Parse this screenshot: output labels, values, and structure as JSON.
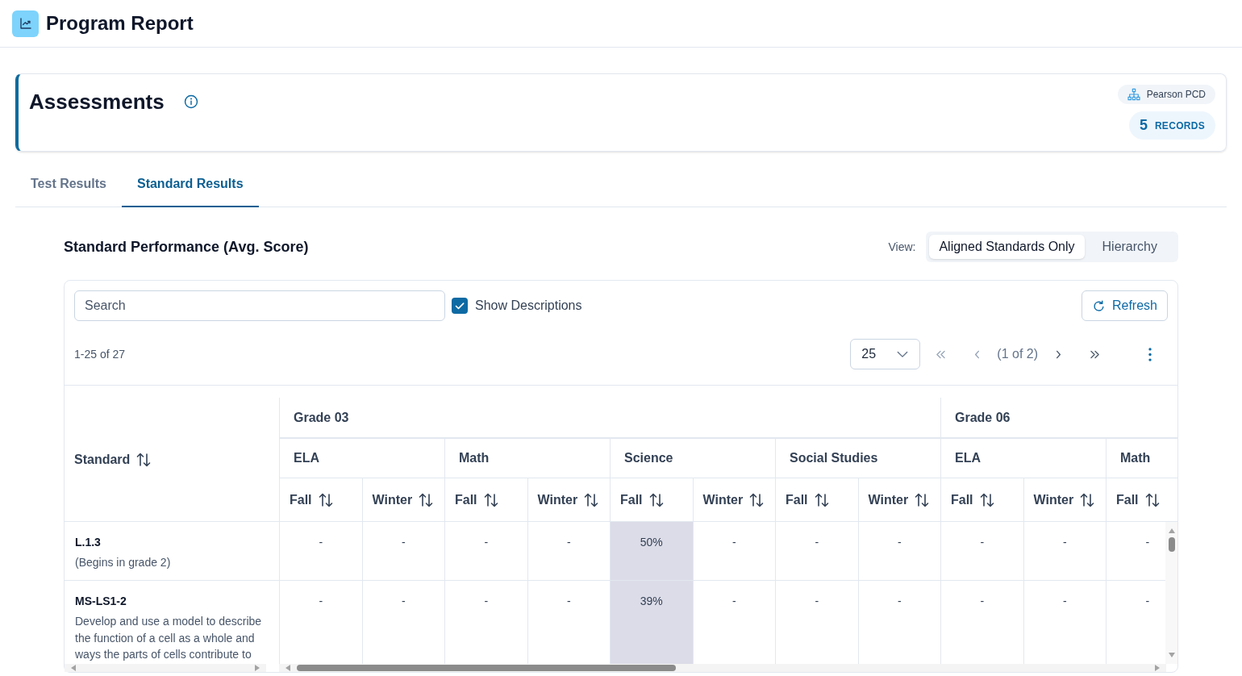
{
  "header": {
    "title": "Program Report"
  },
  "summary": {
    "title": "Assessments",
    "source": "Pearson PCD",
    "record_count": "5",
    "record_label": "RECORDS"
  },
  "tabs": [
    {
      "label": "Test Results",
      "selected": false
    },
    {
      "label": "Standard Results",
      "selected": true
    }
  ],
  "performance": {
    "title": "Standard Performance (Avg. Score)",
    "view_label": "View:",
    "view_options": [
      {
        "label": "Aligned Standards Only",
        "selected": true
      },
      {
        "label": "Hierarchy",
        "selected": false
      }
    ]
  },
  "toolbar": {
    "search": {
      "placeholder": "Search"
    },
    "show_descriptions": {
      "label": "Show Descriptions",
      "checked": true
    },
    "refresh": "Refresh"
  },
  "pagination": {
    "range": "1-25 of 27",
    "page_size": "25",
    "page": "(1 of 2)"
  },
  "table": {
    "standard_header": "Standard",
    "grades": [
      {
        "label": "Grade 03",
        "subjects": [
          {
            "label": "ELA",
            "terms": [
              "Fall",
              "Winter"
            ]
          },
          {
            "label": "Math",
            "terms": [
              "Fall",
              "Winter"
            ]
          },
          {
            "label": "Science",
            "terms": [
              "Fall",
              "Winter"
            ]
          },
          {
            "label": "Social Studies",
            "terms": [
              "Fall",
              "Winter"
            ]
          }
        ]
      },
      {
        "label": "Grade 06",
        "subjects": [
          {
            "label": "ELA",
            "terms": [
              "Fall",
              "Winter"
            ]
          },
          {
            "label": "Math",
            "terms": [
              "Fall"
            ]
          }
        ]
      }
    ],
    "rows": [
      {
        "standard": "L.1.3",
        "description": "(Begins in grade 2)",
        "cells": [
          {
            "value": "-",
            "highlighted": false
          },
          {
            "value": "-",
            "highlighted": false
          },
          {
            "value": "-",
            "highlighted": false
          },
          {
            "value": "-",
            "highlighted": false
          },
          {
            "value": "50%",
            "highlighted": true
          },
          {
            "value": "-",
            "highlighted": false
          },
          {
            "value": "-",
            "highlighted": false
          },
          {
            "value": "-",
            "highlighted": false
          },
          {
            "value": "-",
            "highlighted": false
          },
          {
            "value": "-",
            "highlighted": false
          },
          {
            "value": "-",
            "highlighted": false
          }
        ]
      },
      {
        "standard": "MS-LS1-2",
        "description": "Develop and use a model to describe the function of a cell as a whole and ways the parts of cells contribute to",
        "cells": [
          {
            "value": "-",
            "highlighted": false
          },
          {
            "value": "-",
            "highlighted": false
          },
          {
            "value": "-",
            "highlighted": false
          },
          {
            "value": "-",
            "highlighted": false
          },
          {
            "value": "39%",
            "highlighted": true
          },
          {
            "value": "-",
            "highlighted": false
          },
          {
            "value": "-",
            "highlighted": false
          },
          {
            "value": "-",
            "highlighted": false
          },
          {
            "value": "-",
            "highlighted": false
          },
          {
            "value": "-",
            "highlighted": false
          },
          {
            "value": "-",
            "highlighted": false
          }
        ]
      }
    ]
  }
}
